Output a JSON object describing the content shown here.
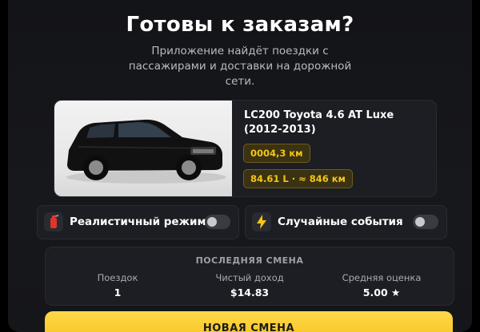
{
  "header": {
    "title": "Готовы к заказам?",
    "subtitle": "Приложение найдёт поездки с пассажирами и доставки на дорожной сети."
  },
  "vehicle": {
    "name": "LC200 Toyota 4.6 AT Luxe (2012-2013)",
    "odometer": "0004,3 км",
    "fuel": "84.61 L · ≈ 846 км"
  },
  "toggles": [
    {
      "label": "Реалистичный режим",
      "icon": "fire-extinguisher-icon",
      "enabled": false
    },
    {
      "label": "Случайные события",
      "icon": "lightning-icon",
      "enabled": false
    }
  ],
  "last_shift": {
    "title": "ПОСЛЕДНЯЯ СМЕНА",
    "stats": [
      {
        "label": "Поездок",
        "value": "1"
      },
      {
        "label": "Чистый доход",
        "value": "$14.83"
      },
      {
        "label": "Средняя оценка",
        "value": "5.00 ★"
      }
    ]
  },
  "cta": {
    "label": "НОВАЯ СМЕНА"
  },
  "colors": {
    "accent": "#f5c518",
    "background": "#151619",
    "card": "#1d1e23"
  }
}
